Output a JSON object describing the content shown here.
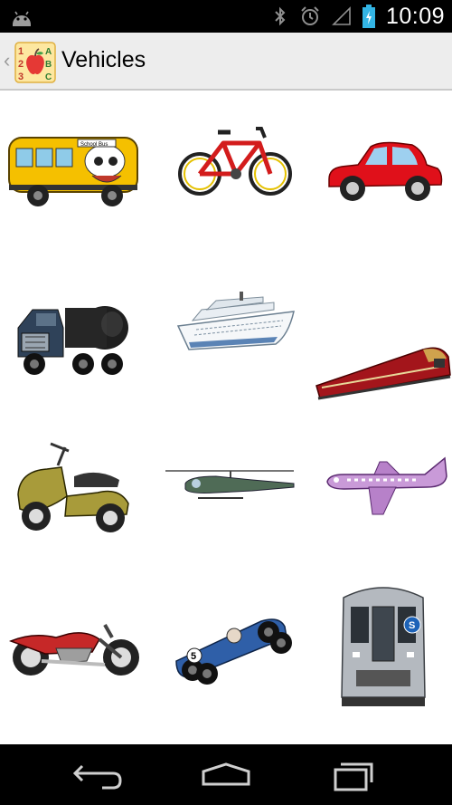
{
  "status_bar": {
    "time": "10:09",
    "icons": [
      "android-icon",
      "bluetooth-icon",
      "alarm-icon",
      "signal-icon",
      "battery-charging-icon"
    ]
  },
  "action_bar": {
    "title": "Vehicles",
    "app_icon": "abc-apple-icon"
  },
  "vehicles": [
    {
      "name": "school-bus",
      "label": "School Bus"
    },
    {
      "name": "bicycle"
    },
    {
      "name": "car"
    },
    {
      "name": "tanker-truck"
    },
    {
      "name": "cruise-ship"
    },
    {
      "name": "train"
    },
    {
      "name": "scooter"
    },
    {
      "name": "helicopter"
    },
    {
      "name": "airplane"
    },
    {
      "name": "motorcycle"
    },
    {
      "name": "race-car",
      "label": "5"
    },
    {
      "name": "subway-train",
      "label": "S"
    }
  ],
  "navigation": [
    "back-icon",
    "home-icon",
    "recent-apps-icon"
  ],
  "colors": {
    "status_bar": "#000000",
    "action_bar": "#ededed",
    "background": "#ffffff",
    "battery": "#33b5e5"
  }
}
